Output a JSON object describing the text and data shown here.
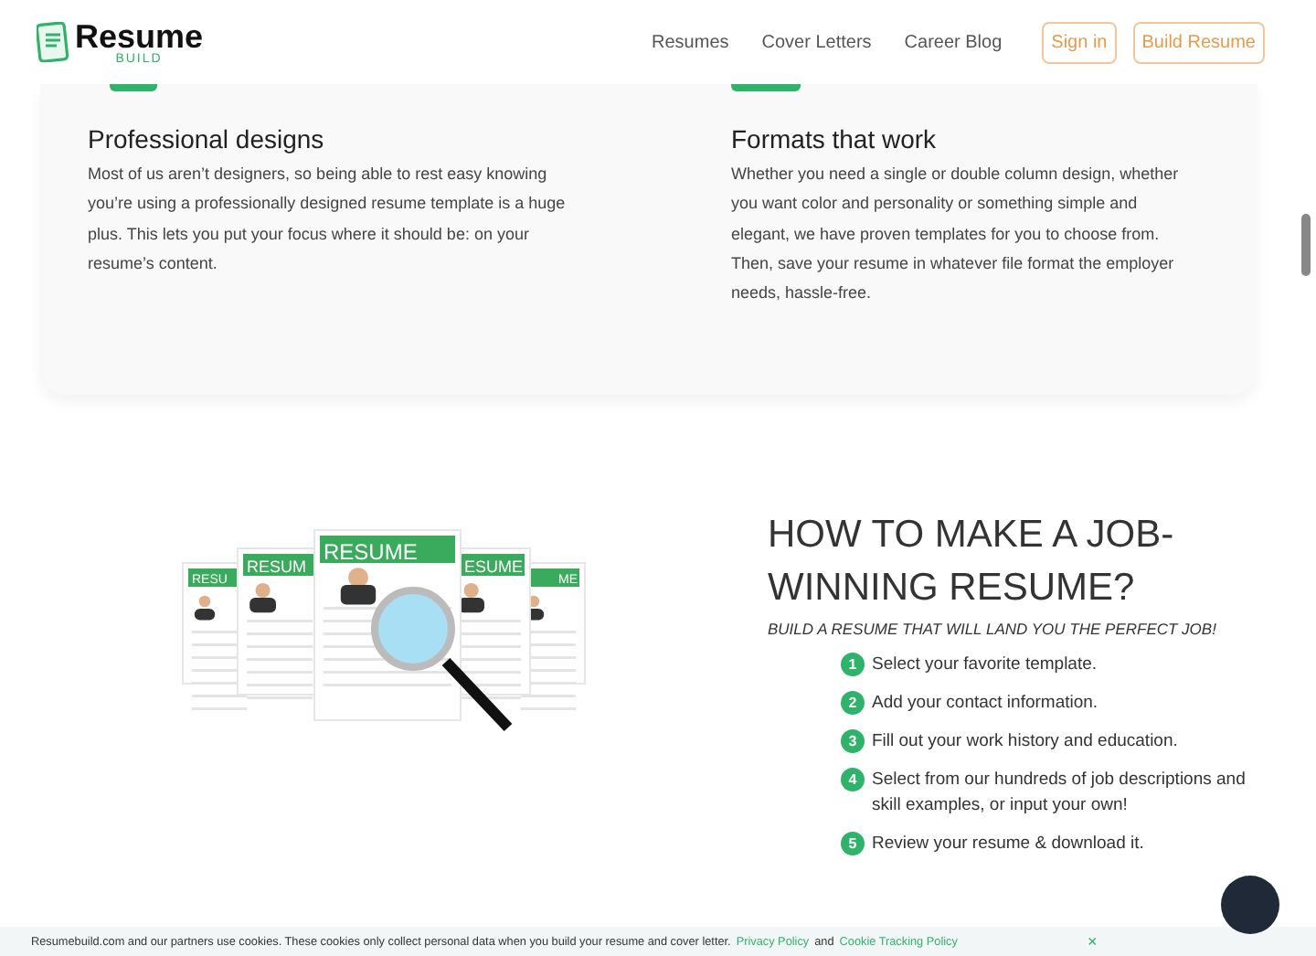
{
  "header": {
    "logo": {
      "title": "Resume",
      "subtitle": "BUILD"
    },
    "nav": [
      {
        "label": "Resumes"
      },
      {
        "label": "Cover Letters"
      },
      {
        "label": "Career Blog"
      }
    ],
    "buttons": [
      {
        "label": "Sign in"
      },
      {
        "label": "Build Resume"
      }
    ]
  },
  "features": [
    {
      "title": "Professional designs",
      "text": "Most of us aren’t designers, so being able to rest easy knowing you’re using a professionally designed resume template is a huge plus. This lets you put your focus where it should be: on your resume’s content."
    },
    {
      "title": "Formats that work",
      "text": "Whether you need a single or double column design, whether you want color and personality or something simple and elegant, we have proven templates for you to choose from. Then, save your resume in whatever file format the employer needs, hassle-free."
    }
  ],
  "illustration": {
    "labels": [
      "RESU",
      "RESUM",
      "RESUME",
      "ESUME",
      "ME"
    ]
  },
  "how_to": {
    "title": "HOW TO MAKE A JOB-WINNING RESUME?",
    "subtitle": "BUILD A RESUME THAT WILL LAND YOU THE PERFECT JOB!",
    "steps": [
      {
        "number": "1",
        "text": "Select your favorite template."
      },
      {
        "number": "2",
        "text": "Add your contact information."
      },
      {
        "number": "3",
        "text": "Fill out your work history and education."
      },
      {
        "number": "4",
        "text": "Select from our hundreds of job descriptions and skill examples, or input your own!"
      },
      {
        "number": "5",
        "text": "Review your resume & download it."
      }
    ]
  },
  "cookie_bar": {
    "text": "Resumebuild.com and our partners use cookies. These cookies only collect personal data when you build your resume and cover letter.",
    "links": [
      "Privacy Policy",
      "Cookie Tracking Policy"
    ],
    "joiner": "and",
    "close": "×"
  }
}
